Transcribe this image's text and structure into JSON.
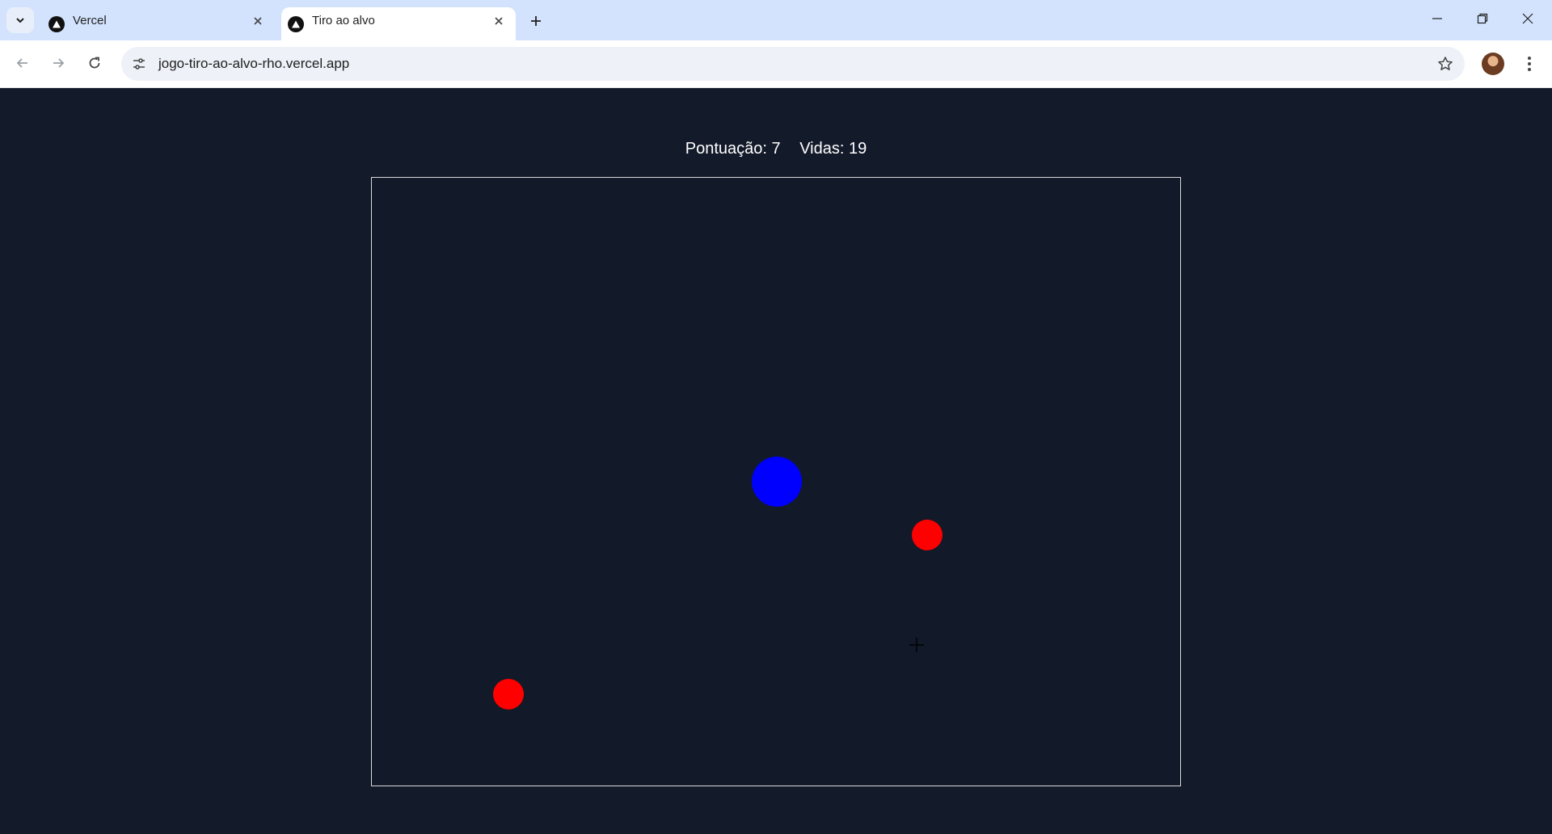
{
  "browser": {
    "tabs": [
      {
        "title": "Vercel",
        "active": false
      },
      {
        "title": "Tiro ao alvo",
        "active": true
      }
    ],
    "url": "jogo-tiro-ao-alvo-rho.vercel.app",
    "icons": {
      "tab_search": "chevron-down-icon",
      "favicon": "vercel-triangle-icon",
      "close": "close-icon",
      "new_tab": "plus-icon",
      "back": "arrow-left-icon",
      "forward": "arrow-right-icon",
      "reload": "reload-icon",
      "site_info": "tune-icon",
      "bookmark": "star-icon",
      "menu": "kebab-icon"
    }
  },
  "game": {
    "score_text": "Pontuação: 7",
    "lives_text": "Vidas: 19",
    "colors": {
      "background": "#131a2a",
      "border": "#d9d9d9",
      "hit_target": "#0000ff",
      "enemy_target": "#ff0000"
    }
  }
}
